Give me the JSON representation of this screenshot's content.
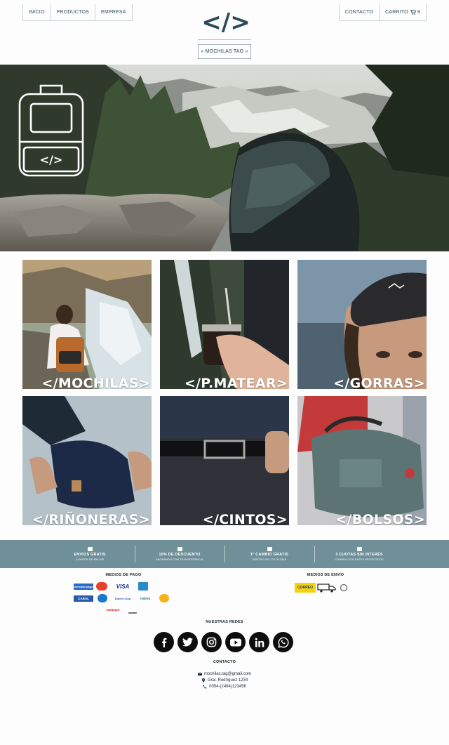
{
  "header": {
    "nav_left": [
      "INICIO",
      "PRODUCTOS",
      "EMPRESA"
    ],
    "nav_contact": "CONTACTO",
    "nav_cart": "CARRITO",
    "cart_count": "9",
    "logo_text": "</>",
    "brand_button": "« MOCHILAS TAG »"
  },
  "hero": {
    "badge_text": "</>"
  },
  "categories": [
    {
      "label": "</MOCHILAS>"
    },
    {
      "label": "</P.MATEAR>"
    },
    {
      "label": "</GORRAS>"
    },
    {
      "label": "</RIÑONERAS>"
    },
    {
      "label": "</CINTOS>"
    },
    {
      "label": "</BOLSOS>"
    }
  ],
  "infobar": {
    "items": [
      {
        "title": "ENVIOS GRATIS",
        "sub": "A PARTIR DE $30.000",
        "icon": "gift-icon"
      },
      {
        "title": "10% DE DESCUENTO",
        "sub": "ABONANDO CON TRANSFERENCIA",
        "icon": "tag-icon"
      },
      {
        "title": "1° CAMBIO GRATIS",
        "sub": "DENTRO DE LOS 30 DÍAS",
        "icon": "truck-icon"
      },
      {
        "title": "3 CUOTAS SIN INTERÉS",
        "sub": "COMPRA CON DATOS PROTEGIDOS",
        "icon": "card-icon"
      }
    ]
  },
  "footer": {
    "payments_title": "MEDIOS DE PAGO",
    "shipping_title": "MEDIOS DE ENVÍO",
    "payments": [
      "mercado pago",
      "mastercard",
      "VISA",
      "amex",
      "naranja",
      "CABAL",
      "maestro",
      "Diners Club",
      "nativa",
      "argencard",
      "rapipago",
      "banco"
    ],
    "shipping": [
      "CORREO",
      "truck",
      "pickup"
    ],
    "social_title": "NUESTRAS REDES",
    "social": [
      "facebook",
      "twitter",
      "instagram",
      "youtube",
      "linkedin",
      "whatsapp"
    ],
    "contact_title": "CONTACTO",
    "email": "mochilas.tag@gmail.com",
    "address": "Gral. Rodríguez 1234",
    "phone": "0054-(2494)123456"
  },
  "colors": {
    "primary": "#2a4a5a",
    "infobar": "#6f8f99",
    "background": "#fdfdfd"
  }
}
